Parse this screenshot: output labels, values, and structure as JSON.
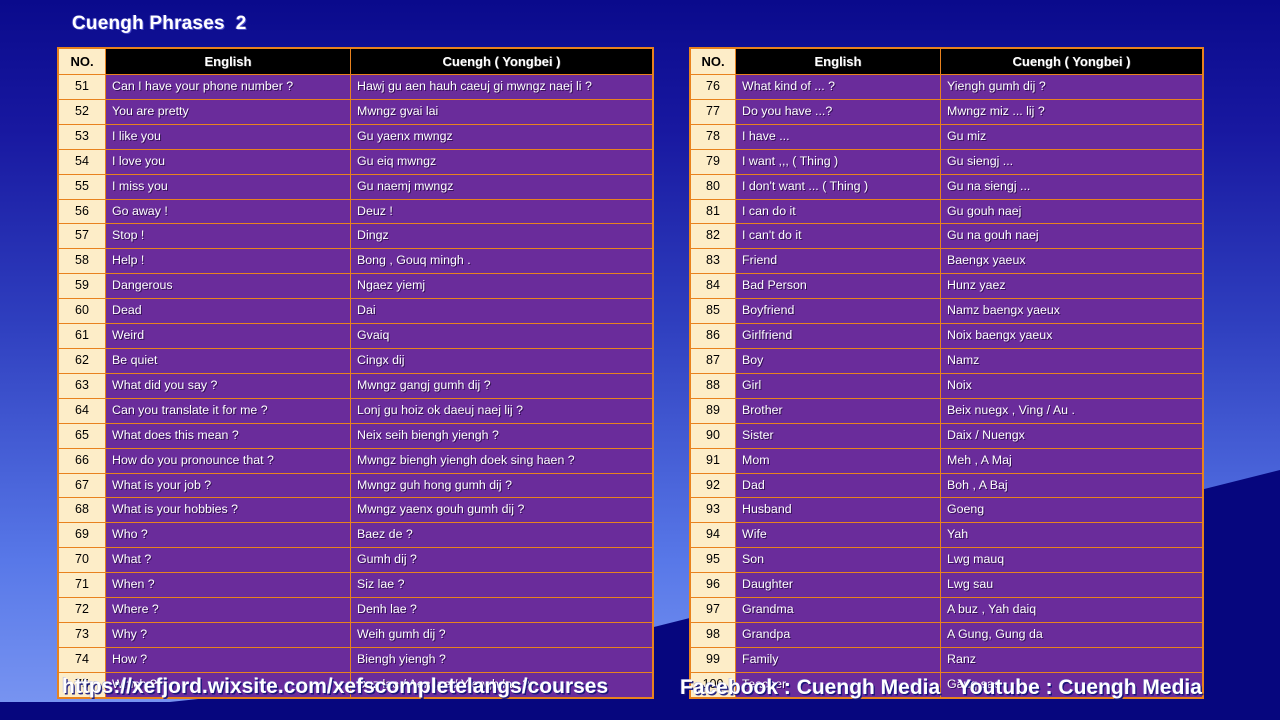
{
  "slide": {
    "title": "Cuengh Phrases  2",
    "background_top_color": "#0a0a8c",
    "background_bottom_color": "#7b97f2",
    "wedge_color": "#06067e"
  },
  "theme": {
    "border_color": "#e8821e",
    "row_purple": "#6a2c9b",
    "no_column_cream": "#fdedc8",
    "header_black": "#000000",
    "text_white": "#ffffff"
  },
  "columns": {
    "no": "NO.",
    "english": "English",
    "cuengh": "Cuengh ( Yongbei )"
  },
  "table_left": {
    "rows": [
      {
        "no": "51",
        "english": "Can I have your phone number ?",
        "cuengh": "Hawj gu aen hauh caeuj gi mwngz naej li ?"
      },
      {
        "no": "52",
        "english": "You are pretty",
        "cuengh": "Mwngz gvai lai"
      },
      {
        "no": "53",
        "english": "I like you",
        "cuengh": "Gu yaenx mwngz"
      },
      {
        "no": "54",
        "english": "I love you",
        "cuengh": "Gu eiq mwngz"
      },
      {
        "no": "55",
        "english": "I miss you",
        "cuengh": "Gu naemj mwngz"
      },
      {
        "no": "56",
        "english": "Go away !",
        "cuengh": "Deuz !"
      },
      {
        "no": "57",
        "english": "Stop !",
        "cuengh": "Dingz"
      },
      {
        "no": "58",
        "english": "Help !",
        "cuengh": "Bong , Gouq mingh ."
      },
      {
        "no": "59",
        "english": "Dangerous",
        "cuengh": "Ngaez yiemj"
      },
      {
        "no": "60",
        "english": "Dead",
        "cuengh": "Dai"
      },
      {
        "no": "61",
        "english": "Weird",
        "cuengh": "Gvaiq"
      },
      {
        "no": "62",
        "english": "Be quiet",
        "cuengh": "Cingx dij"
      },
      {
        "no": "63",
        "english": "What did you say ?",
        "cuengh": "Mwngz gangj gumh dij ?"
      },
      {
        "no": "64",
        "english": "Can you translate it for me ?",
        "cuengh": "Lonj gu hoiz ok daeuj naej lij ?"
      },
      {
        "no": "65",
        "english": "What does this mean ?",
        "cuengh": "Neix seih biengh yiengh ?"
      },
      {
        "no": "66",
        "english": "How do you pronounce that ?",
        "cuengh": "Mwngz biengh yiengh doek sing haen ?"
      },
      {
        "no": "67",
        "english": "What is your job ?",
        "cuengh": "Mwngz guh hong gumh dij ?"
      },
      {
        "no": "68",
        "english": "What is your hobbies ?",
        "cuengh": "Mwngz yaenx gouh gumh dij ?"
      },
      {
        "no": "69",
        "english": "Who ?",
        "cuengh": "Baez de ?"
      },
      {
        "no": "70",
        "english": "What ?",
        "cuengh": "Gumh dij ?"
      },
      {
        "no": "71",
        "english": "When ?",
        "cuengh": "Siz lae ?"
      },
      {
        "no": "72",
        "english": "Where ?",
        "cuengh": "Denh lae ?"
      },
      {
        "no": "73",
        "english": "Why ?",
        "cuengh": "Weih gumh dij ?"
      },
      {
        "no": "74",
        "english": "How ?",
        "cuengh": "Biengh yiengh ?"
      },
      {
        "no": "75",
        "english": "Which ?",
        "cuengh": "Duz lae / Aen lae / Yiengh lae ?"
      }
    ]
  },
  "table_right": {
    "rows": [
      {
        "no": "76",
        "english": "What kind of ... ?",
        "cuengh": "Yiengh gumh dij ?"
      },
      {
        "no": "77",
        "english": "Do you have ...?",
        "cuengh": "Mwngz miz ... lij ?"
      },
      {
        "no": "78",
        "english": "I have ...",
        "cuengh": "Gu miz"
      },
      {
        "no": "79",
        "english": "I want ,,, ( Thing )",
        "cuengh": "Gu siengj ..."
      },
      {
        "no": "80",
        "english": "I don't want ... ( Thing )",
        "cuengh": "Gu na siengj ..."
      },
      {
        "no": "81",
        "english": "I can do it",
        "cuengh": "Gu gouh naej"
      },
      {
        "no": "82",
        "english": "I can't do it",
        "cuengh": "Gu na gouh naej"
      },
      {
        "no": "83",
        "english": "Friend",
        "cuengh": "Baengx yaeux"
      },
      {
        "no": "84",
        "english": "Bad Person",
        "cuengh": "Hunz yaez"
      },
      {
        "no": "85",
        "english": "Boyfriend",
        "cuengh": "Namz baengx yaeux"
      },
      {
        "no": "86",
        "english": "Girlfriend",
        "cuengh": "Noix baengx yaeux"
      },
      {
        "no": "87",
        "english": "Boy",
        "cuengh": "Namz"
      },
      {
        "no": "88",
        "english": "Girl",
        "cuengh": "Noix"
      },
      {
        "no": "89",
        "english": "Brother",
        "cuengh": "Beix nuegx , Ving / Au ."
      },
      {
        "no": "90",
        "english": "Sister",
        "cuengh": "Daix / Nuengx"
      },
      {
        "no": "91",
        "english": "Mom",
        "cuengh": "Meh ,   A Maj"
      },
      {
        "no": "92",
        "english": "Dad",
        "cuengh": "Boh ,   A Baj"
      },
      {
        "no": "93",
        "english": "Husband",
        "cuengh": "Goeng"
      },
      {
        "no": "94",
        "english": "Wife",
        "cuengh": "Yah"
      },
      {
        "no": "95",
        "english": "Son",
        "cuengh": "Lwg mauq"
      },
      {
        "no": "96",
        "english": "Daughter",
        "cuengh": "Lwg sau"
      },
      {
        "no": "97",
        "english": "Grandma",
        "cuengh": "A buz ,    Yah daiq"
      },
      {
        "no": "98",
        "english": "Grandpa",
        "cuengh": "A Gung,  Gung da"
      },
      {
        "no": "99",
        "english": "Family",
        "cuengh": "Ranz"
      },
      {
        "no": "100",
        "english": "Teacher",
        "cuengh": "Gauq sae"
      }
    ]
  },
  "footer": {
    "url": "https://xefjord.wixsite.com/xefscompletelangs/courses",
    "social": "Facebook : Cuengh Media   Youtube : Cuengh Media"
  }
}
